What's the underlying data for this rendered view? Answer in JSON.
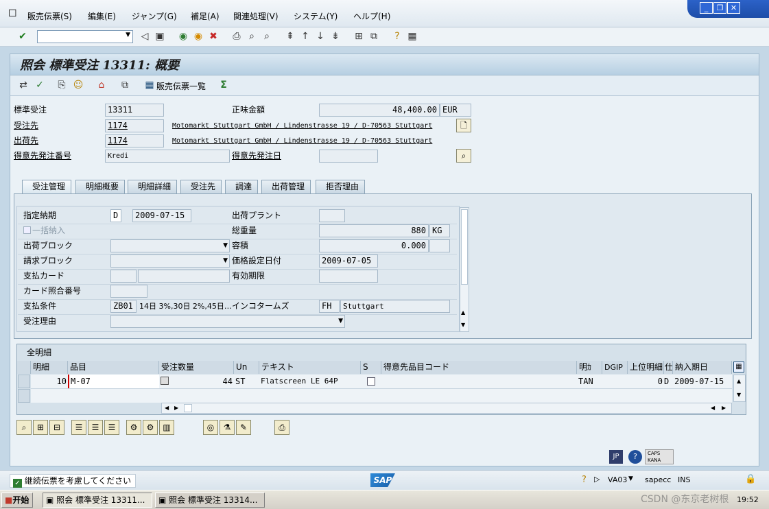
{
  "menu": {
    "items": [
      "販売伝票(S)",
      "編集(E)",
      "ジャンプ(G)",
      "補足(A)",
      "関連処理(V)",
      "システム(Y)",
      "ヘルプ(H)"
    ]
  },
  "window_controls": {
    "minimize": "_",
    "restore": "❐",
    "close": "✕"
  },
  "title": "照会 標準受注 13311: 概要",
  "app_toolbar": {
    "sales_doc_list": "販売伝票一覧"
  },
  "header": {
    "order_label": "標準受注",
    "order_number": "13311",
    "net_value_label": "正味金額",
    "net_value": "48,400.00",
    "currency": "EUR",
    "sold_to_label": "受注先",
    "sold_to_number": "1174",
    "sold_to_address": "Motomarkt Stuttgart GmbH / Lindenstrasse 19 / D-70563 Stuttgart",
    "ship_to_label": "出荷先",
    "ship_to_number": "1174",
    "ship_to_address": "Motomarkt Stuttgart GmbH / Lindenstrasse 19 / D-70563 Stuttgart",
    "po_number_label": "得意先発注番号",
    "po_number": "Kredi",
    "po_date_label": "得意先発注日",
    "po_date": ""
  },
  "tabs": [
    "受注管理",
    "明細概要",
    "明細詳細",
    "受注先",
    "調達",
    "出荷管理",
    "拒否理由"
  ],
  "sales_tab": {
    "req_deliv_date_label": "指定納期",
    "req_deliv_date_type": "D",
    "req_deliv_date": "2009-07-15",
    "complete_deliv_label": "一括納入",
    "delivery_block_label": "出荷ブロック",
    "billing_block_label": "請求ブロック",
    "payment_card_label": "支払カード",
    "card_verif_label": "カード照合番号",
    "payment_terms_label": "支払条件",
    "payment_terms_code": "ZB01",
    "payment_terms_text": "14日 3%,30日 2%,45日…",
    "order_reason_label": "受注理由",
    "delivering_plant_label": "出荷プラント",
    "delivering_plant": "",
    "total_weight_label": "総重量",
    "total_weight": "880",
    "weight_unit": "KG",
    "volume_label": "容積",
    "volume": "0.000",
    "volume_unit": "",
    "pricing_date_label": "価格設定日付",
    "pricing_date": "2009-07-05",
    "valid_to_label": "有効期限",
    "valid_to": "",
    "incoterms_label": "インコタームズ",
    "incoterms_code": "FH",
    "incoterms_place": "Stuttgart"
  },
  "items_table": {
    "title": "全明細",
    "columns": [
      "明細",
      "品目",
      "受注数量",
      "Un",
      "テキスト",
      "S",
      "得意先品目コード",
      "明ｶ",
      "DGIP",
      "上位明細",
      "仕",
      "納入期日"
    ],
    "rows": [
      {
        "item": "10",
        "material": "M-07",
        "quantity": "44",
        "unit": "ST",
        "text": "Flatscreen LE 64P",
        "s": "",
        "cust_material": "",
        "category": "TAN",
        "dgip": "",
        "higher_item": "0",
        "d": "D",
        "deliv_date": "2009-07-15"
      }
    ]
  },
  "status_bar": {
    "checkbox_label": "継続伝票を考慮してください",
    "sap_logo": "SAP",
    "transaction": "VA03",
    "server": "sapecc",
    "mode": "INS",
    "lang": "JP",
    "caps": "CAPS",
    "kana": "KANA"
  },
  "taskbar": {
    "start": "开始",
    "tasks": [
      "照会 標準受注 13311...",
      "照会 標準受注 13314..."
    ],
    "clock": "19:52",
    "watermark": "CSDN @东京老树根"
  },
  "colors": {
    "title_bg": "#b6cfe2",
    "panel_bg": "#eaf1f6",
    "link": "#000000"
  }
}
